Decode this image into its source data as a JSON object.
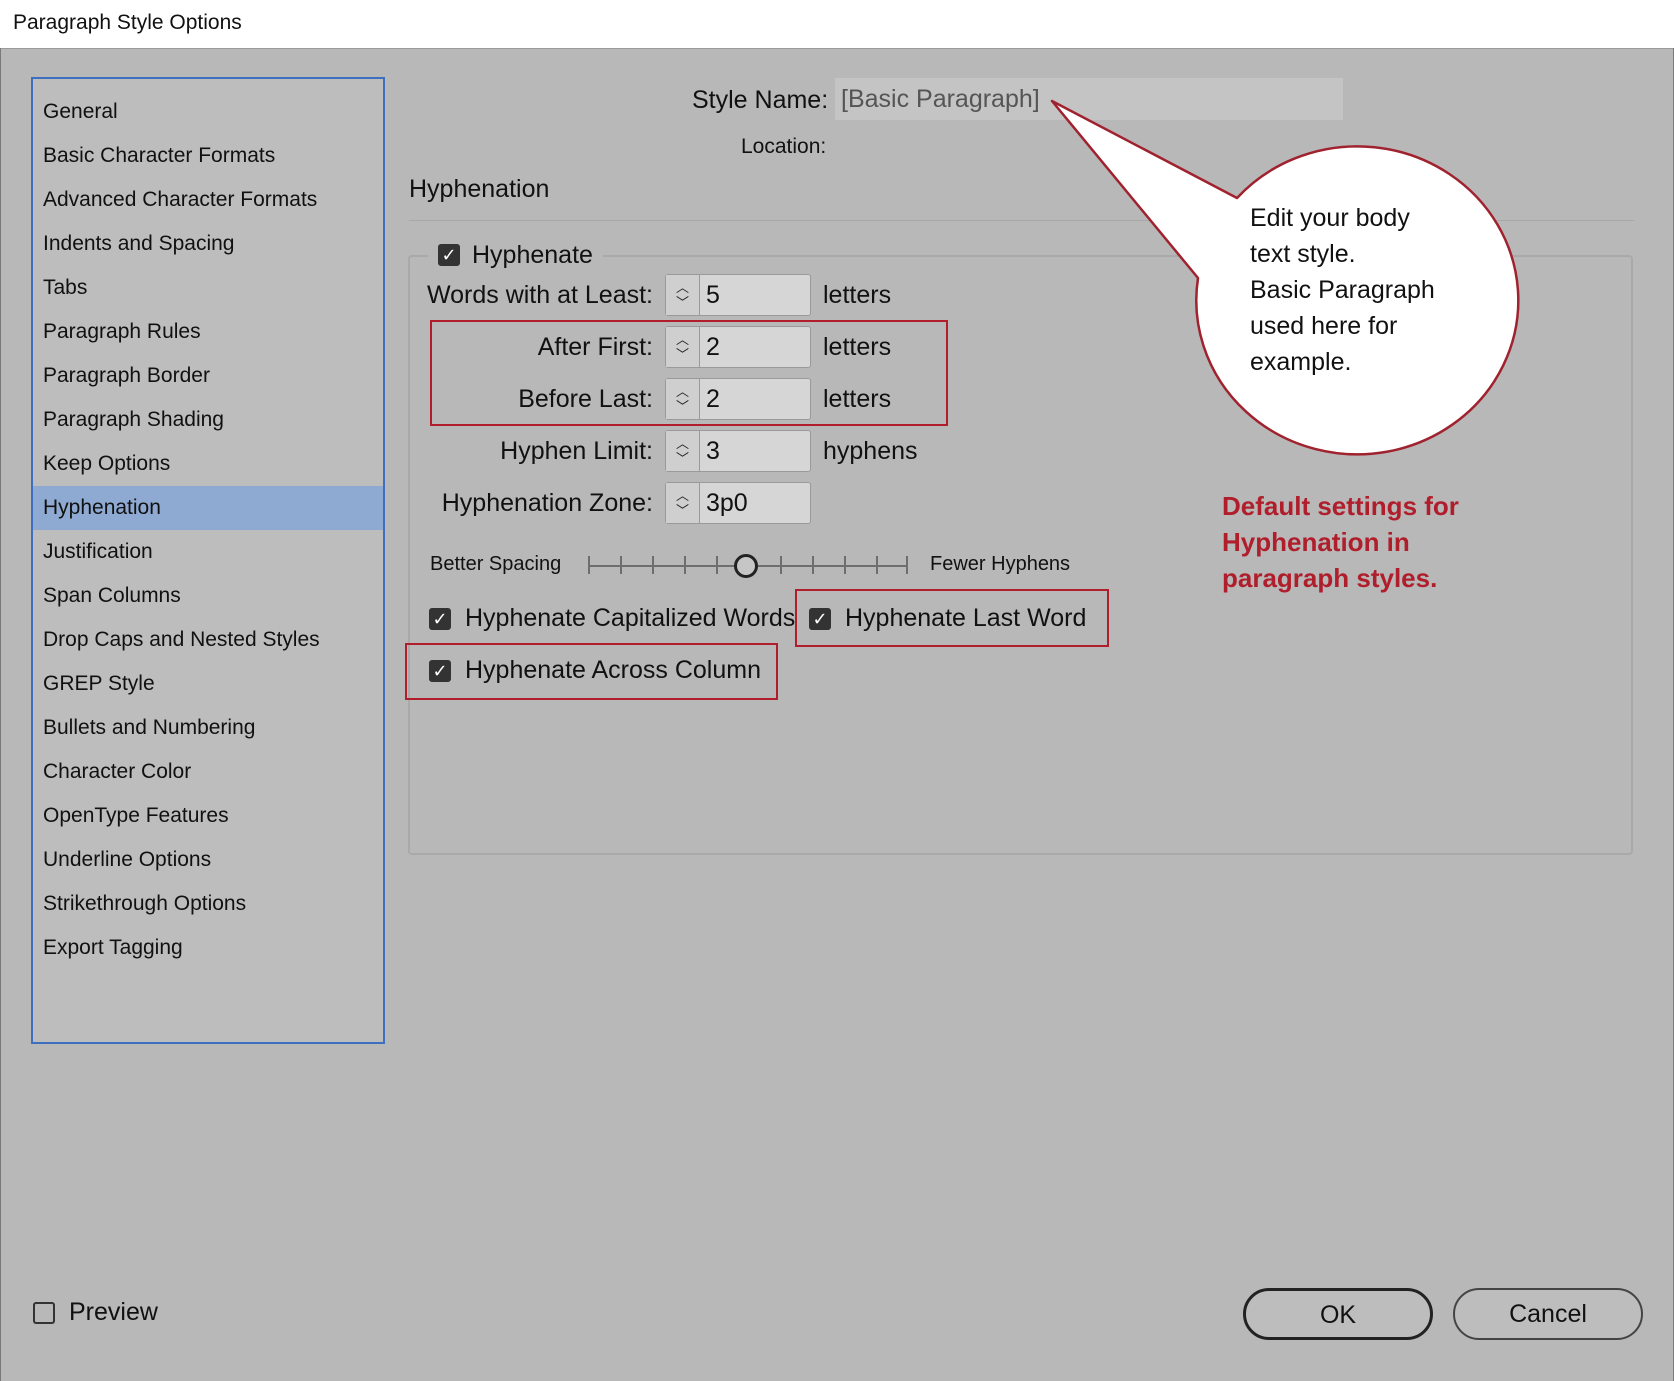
{
  "window": {
    "title": "Paragraph Style Options"
  },
  "sidebar": {
    "items": [
      {
        "label": "General"
      },
      {
        "label": "Basic Character Formats"
      },
      {
        "label": "Advanced Character Formats"
      },
      {
        "label": "Indents and Spacing"
      },
      {
        "label": "Tabs"
      },
      {
        "label": "Paragraph Rules"
      },
      {
        "label": "Paragraph Border"
      },
      {
        "label": "Paragraph Shading"
      },
      {
        "label": "Keep Options"
      },
      {
        "label": "Hyphenation",
        "selected": true
      },
      {
        "label": "Justification"
      },
      {
        "label": "Span Columns"
      },
      {
        "label": "Drop Caps and Nested Styles"
      },
      {
        "label": "GREP Style"
      },
      {
        "label": "Bullets and Numbering"
      },
      {
        "label": "Character Color"
      },
      {
        "label": "OpenType Features"
      },
      {
        "label": "Underline Options"
      },
      {
        "label": "Strikethrough Options"
      },
      {
        "label": "Export Tagging"
      }
    ]
  },
  "header": {
    "style_name_label": "Style Name:",
    "style_name_value": "[Basic Paragraph]",
    "location_label": "Location:"
  },
  "section": {
    "title": "Hyphenation"
  },
  "hyphenation": {
    "hyphenate": {
      "label": "Hyphenate",
      "checked": true
    },
    "words_with_at_least": {
      "label": "Words with at Least:",
      "value": "5",
      "unit": "letters"
    },
    "after_first": {
      "label": "After First:",
      "value": "2",
      "unit": "letters"
    },
    "before_last": {
      "label": "Before Last:",
      "value": "2",
      "unit": "letters"
    },
    "hyphen_limit": {
      "label": "Hyphen Limit:",
      "value": "3",
      "unit": "hyphens"
    },
    "hyphenation_zone": {
      "label": "Hyphenation Zone:",
      "value": "3p0"
    },
    "slider": {
      "left_label": "Better Spacing",
      "right_label": "Fewer Hyphens",
      "position_fraction": 0.5
    },
    "hyphenate_capitalized_words": {
      "label": "Hyphenate Capitalized Words",
      "checked": true
    },
    "hyphenate_last_word": {
      "label": "Hyphenate Last Word",
      "checked": true
    },
    "hyphenate_across_column": {
      "label": "Hyphenate Across Column",
      "checked": true
    }
  },
  "callout": {
    "lines": [
      "Edit your body",
      "text style.",
      "Basic Paragraph",
      "used here for",
      "example."
    ]
  },
  "annotation": {
    "lines": [
      "Default settings for",
      "Hyphenation in",
      "paragraph styles."
    ],
    "color": "#b01e2c"
  },
  "footer": {
    "preview": {
      "label": "Preview",
      "checked": false
    },
    "ok_label": "OK",
    "cancel_label": "Cancel"
  },
  "colors": {
    "dialog_bg": "#b8b8b8",
    "selection": "#8eaad2",
    "focus_border": "#3c6fc0",
    "highlight_red": "#b01e2c"
  },
  "icons": {
    "checkbox_checked": "check-mark",
    "spinner": "up-down-chevrons"
  }
}
